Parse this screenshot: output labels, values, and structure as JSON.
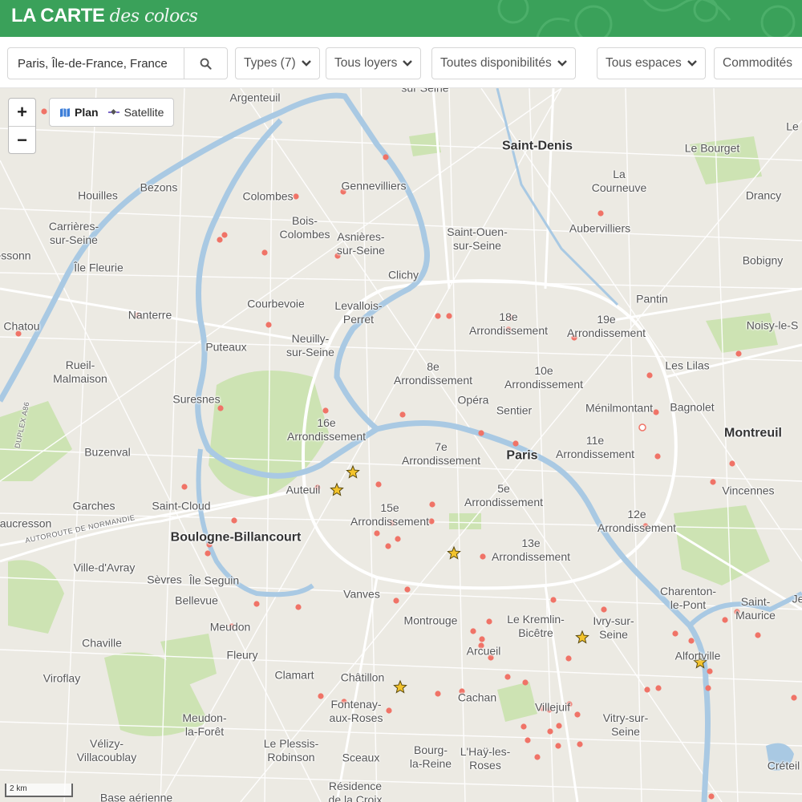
{
  "header": {
    "brand_bold": "LA CARTE",
    "brand_italic": "des colocs"
  },
  "filters": {
    "search_value": "Paris, Île-de-France, France",
    "types": "Types (7)",
    "rent": "Tous loyers",
    "availability": "Toutes disponibilités",
    "spaces": "Tous espaces",
    "amenities": "Commodités"
  },
  "map_controls": {
    "zoom_in": "+",
    "zoom_out": "−",
    "plan": "Plan",
    "satellite": "Satellite",
    "scale": "2 km",
    "plan_icon": "map-icon",
    "satellite_icon": "satellite-icon"
  },
  "colors": {
    "brand": "#3aa15a",
    "listing_dot": "#f07367",
    "featured_star": "#f3c32b",
    "water": "#a9c9e3",
    "park": "#cde3b3"
  },
  "labels": {
    "argenteuil": "Argenteuil",
    "saint_denis": "Saint-Denis",
    "le_bourget": "Le Bourget",
    "la_courneuve": "La\nCourneuve",
    "drancy": "Drancy",
    "houilles": "Houilles",
    "bezons": "Bezons",
    "colombes": "Colombes",
    "gennevilliers": "Gennevilliers",
    "aubervilliers": "Aubervilliers",
    "carrieres": "Carrières-\nsur-Seine",
    "bois_colombes": "Bois-\nColombes",
    "asnieres": "Asnières-\nsur-Seine",
    "saint_ouen": "Saint-Ouen-\nsur-Seine",
    "essonn": "essonn",
    "ile_fleurie": "Île Fleurie",
    "bobigny": "Bobigny",
    "clichy": "Clichy",
    "pantin": "Pantin",
    "chatou": "Chatou",
    "nanterre": "Nanterre",
    "courbevoie": "Courbevoie",
    "levallois": "Levallois-\nPerret",
    "arr18": "18e\nArrondissement",
    "arr19": "19e\nArrondissement",
    "noisy": "Noisy-le-S",
    "puteaux": "Puteaux",
    "neuilly": "Neuilly-\nsur-Seine",
    "rueil": "Rueil-\nMalmaison",
    "arr8": "8e\nArrondissement",
    "arr10": "10e\nArrondissement",
    "les_lilas": "Les Lilas",
    "suresnes": "Suresnes",
    "opera": "Opéra",
    "sentier": "Sentier",
    "menilmontant": "Ménilmontant",
    "bagnolet": "Bagnolet",
    "arr16": "16e\nArrondissement",
    "paris": "Paris",
    "arr7": "7e\nArrondissement",
    "arr11": "11e\nArrondissement",
    "montreuil": "Montreuil",
    "buzenval": "Buzenval",
    "auteuil": "Auteuil",
    "arr5": "5e\nArrondissement",
    "vincennes": "Vincennes",
    "garches": "Garches",
    "saint_cloud": "Saint-Cloud",
    "arr15": "15e\nArrondissement",
    "arr12": "12e\nArrondissement",
    "aucresson": "aucresson",
    "boulogne": "Boulogne-Billancourt",
    "arr13": "13e\nArrondissement",
    "ville_davray": "Ville-d'Avray",
    "sevres": "Sèvres",
    "ile_seguin": "Île Seguin",
    "charenton": "Charenton-\nle-Pont",
    "saint_maurice": "Saint-\nMaurice",
    "bellevue": "Bellevue",
    "vanves": "Vanves",
    "meudon": "Meudon",
    "montrouge": "Montrouge",
    "kremlin": "Le Kremlin-\nBicêtre",
    "ivry": "Ivry-sur-\nSeine",
    "chaville": "Chaville",
    "arcueil": "Arcueil",
    "alfortville": "Alfortville",
    "fleury": "Fleury",
    "viroflay": "Viroflay",
    "clamart": "Clamart",
    "chatillon": "Châtillon",
    "cachan": "Cachan",
    "fontenay": "Fontenay-\naux-Roses",
    "villejuif": "Villejuif",
    "meudon_foret": "Meudon-\nla-Forêt",
    "vitry": "Vitry-sur-\nSeine",
    "velizy": "Vélizy-\nVillacoublay",
    "plessis": "Le Plessis-\nRobinson",
    "sceaux": "Sceaux",
    "bourg_la_reine": "Bourg-\nla-Reine",
    "hay_les_roses": "L'Haÿ-les-\nRoses",
    "creteil": "Créteil",
    "residence": "Résidence\nde la Croix",
    "base_aerienne": "Base aérienne",
    "le_top": "Le",
    "je": "Je",
    "sur_seine_top": "sur Seine",
    "a86": "DUPLEX A86",
    "autoroute": "AUTOROUTE DE NORMANDIE"
  },
  "markers": {
    "listing_count": 95,
    "featured_count": 6
  }
}
